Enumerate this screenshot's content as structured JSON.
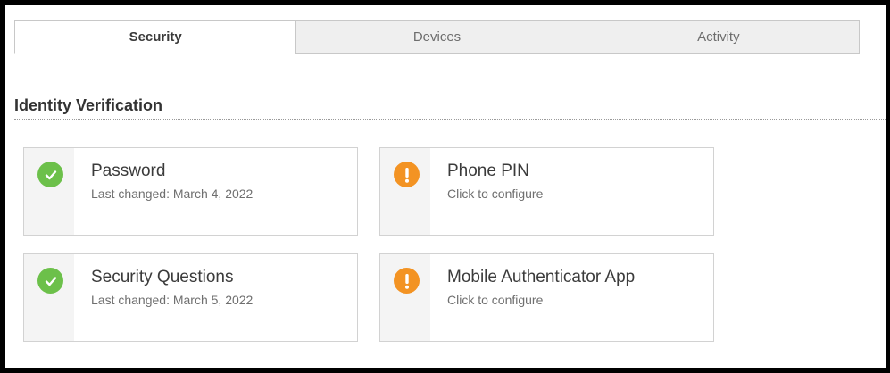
{
  "tabs": [
    {
      "label": "Security",
      "active": true
    },
    {
      "label": "Devices",
      "active": false
    },
    {
      "label": "Activity",
      "active": false
    }
  ],
  "section": {
    "title": "Identity Verification"
  },
  "colors": {
    "ok": "#6cc04a",
    "warning": "#f39323"
  },
  "methods": [
    {
      "title": "Password",
      "subtitle": "Last changed: March 4, 2022",
      "status": "configured",
      "icon": "check-circle-icon"
    },
    {
      "title": "Phone PIN",
      "subtitle": "Click to configure",
      "status": "not-configured",
      "icon": "exclamation-circle-icon"
    },
    {
      "title": "Security Questions",
      "subtitle": "Last changed: March 5, 2022",
      "status": "configured",
      "icon": "check-circle-icon"
    },
    {
      "title": "Mobile Authenticator App",
      "subtitle": "Click to configure",
      "status": "not-configured",
      "icon": "exclamation-circle-icon"
    }
  ]
}
